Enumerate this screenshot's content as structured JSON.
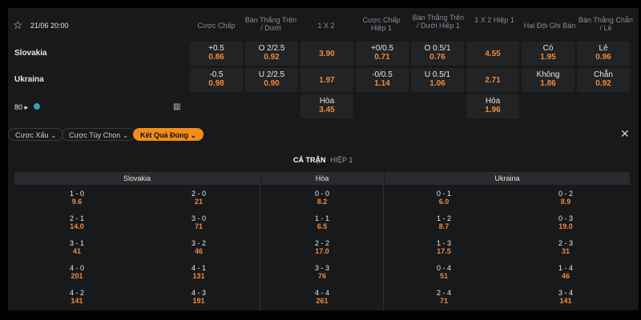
{
  "match": {
    "datetime": "21/06 20:00",
    "team_home": "Slovakia",
    "team_away": "Ukraina",
    "more_count": "80"
  },
  "headers": [
    "Cược Chấp",
    "Bàn Thắng Trên / Dưới",
    "1 X 2",
    "Cược Chấp Hiệp 1",
    "Bàn Thắng Trên / Dưới Hiệp 1",
    "1 X 2 Hiệp 1",
    "Hai Đội Ghi Bàn",
    "Bàn Thắng Chẵn / Lẻ"
  ],
  "home_odds": [
    {
      "top": "+0.5",
      "val": "0.86"
    },
    {
      "top": "O 2/2.5",
      "val": "0.92"
    },
    {
      "top": "",
      "val": "3.90"
    },
    {
      "top": "+0/0.5",
      "val": "0.71"
    },
    {
      "top": "O 0.5/1",
      "val": "0.76"
    },
    {
      "top": "",
      "val": "4.55"
    },
    {
      "top": "Có",
      "val": "1.95"
    },
    {
      "top": "Lẻ",
      "val": "0.96"
    }
  ],
  "away_odds": [
    {
      "top": "-0.5",
      "val": "0.98"
    },
    {
      "top": "U 2/2.5",
      "val": "0.90"
    },
    {
      "top": "",
      "val": "1.97"
    },
    {
      "top": "-0/0.5",
      "val": "1.14"
    },
    {
      "top": "U 0.5/1",
      "val": "1.06"
    },
    {
      "top": "",
      "val": "2.71"
    },
    {
      "top": "Không",
      "val": "1.86"
    },
    {
      "top": "Chẵn",
      "val": "0.92"
    }
  ],
  "draw_odds": [
    {
      "top": "Hòa",
      "val": "3.45"
    },
    {
      "top": "Hòa",
      "val": "1.96"
    }
  ],
  "filters": [
    {
      "label": "Cược Xấu ⌄"
    },
    {
      "label": "Cược Tùy Chọn ⌄"
    },
    {
      "label": "Kết Quả Đúng ⌄"
    }
  ],
  "tabs": {
    "full": "CẢ TRẬN",
    "half": "HIỆP 1"
  },
  "groups": {
    "home": "Slovakia",
    "draw": "Hòa",
    "away": "Ukraina"
  },
  "scores": {
    "home_a": [
      {
        "s": "1 - 0",
        "o": "9.6"
      },
      {
        "s": "2 - 1",
        "o": "14.0"
      },
      {
        "s": "3 - 1",
        "o": "41"
      },
      {
        "s": "4 - 0",
        "o": "201"
      },
      {
        "s": "4 - 2",
        "o": "141"
      }
    ],
    "home_b": [
      {
        "s": "2 - 0",
        "o": "21"
      },
      {
        "s": "3 - 0",
        "o": "71"
      },
      {
        "s": "3 - 2",
        "o": "46"
      },
      {
        "s": "4 - 1",
        "o": "131"
      },
      {
        "s": "4 - 3",
        "o": "191"
      }
    ],
    "draw": [
      {
        "s": "0 - 0",
        "o": "8.2"
      },
      {
        "s": "1 - 1",
        "o": "6.5"
      },
      {
        "s": "2 - 2",
        "o": "17.0"
      },
      {
        "s": "3 - 3",
        "o": "76"
      },
      {
        "s": "4 - 4",
        "o": "261"
      }
    ],
    "away_a": [
      {
        "s": "0 - 1",
        "o": "6.0"
      },
      {
        "s": "1 - 2",
        "o": "8.7"
      },
      {
        "s": "1 - 3",
        "o": "17.5"
      },
      {
        "s": "0 - 4",
        "o": "51"
      },
      {
        "s": "2 - 4",
        "o": "71"
      }
    ],
    "away_b": [
      {
        "s": "0 - 2",
        "o": "8.9"
      },
      {
        "s": "0 - 3",
        "o": "19.0"
      },
      {
        "s": "2 - 3",
        "o": "31"
      },
      {
        "s": "1 - 4",
        "o": "46"
      },
      {
        "s": "3 - 4",
        "o": "141"
      }
    ]
  }
}
